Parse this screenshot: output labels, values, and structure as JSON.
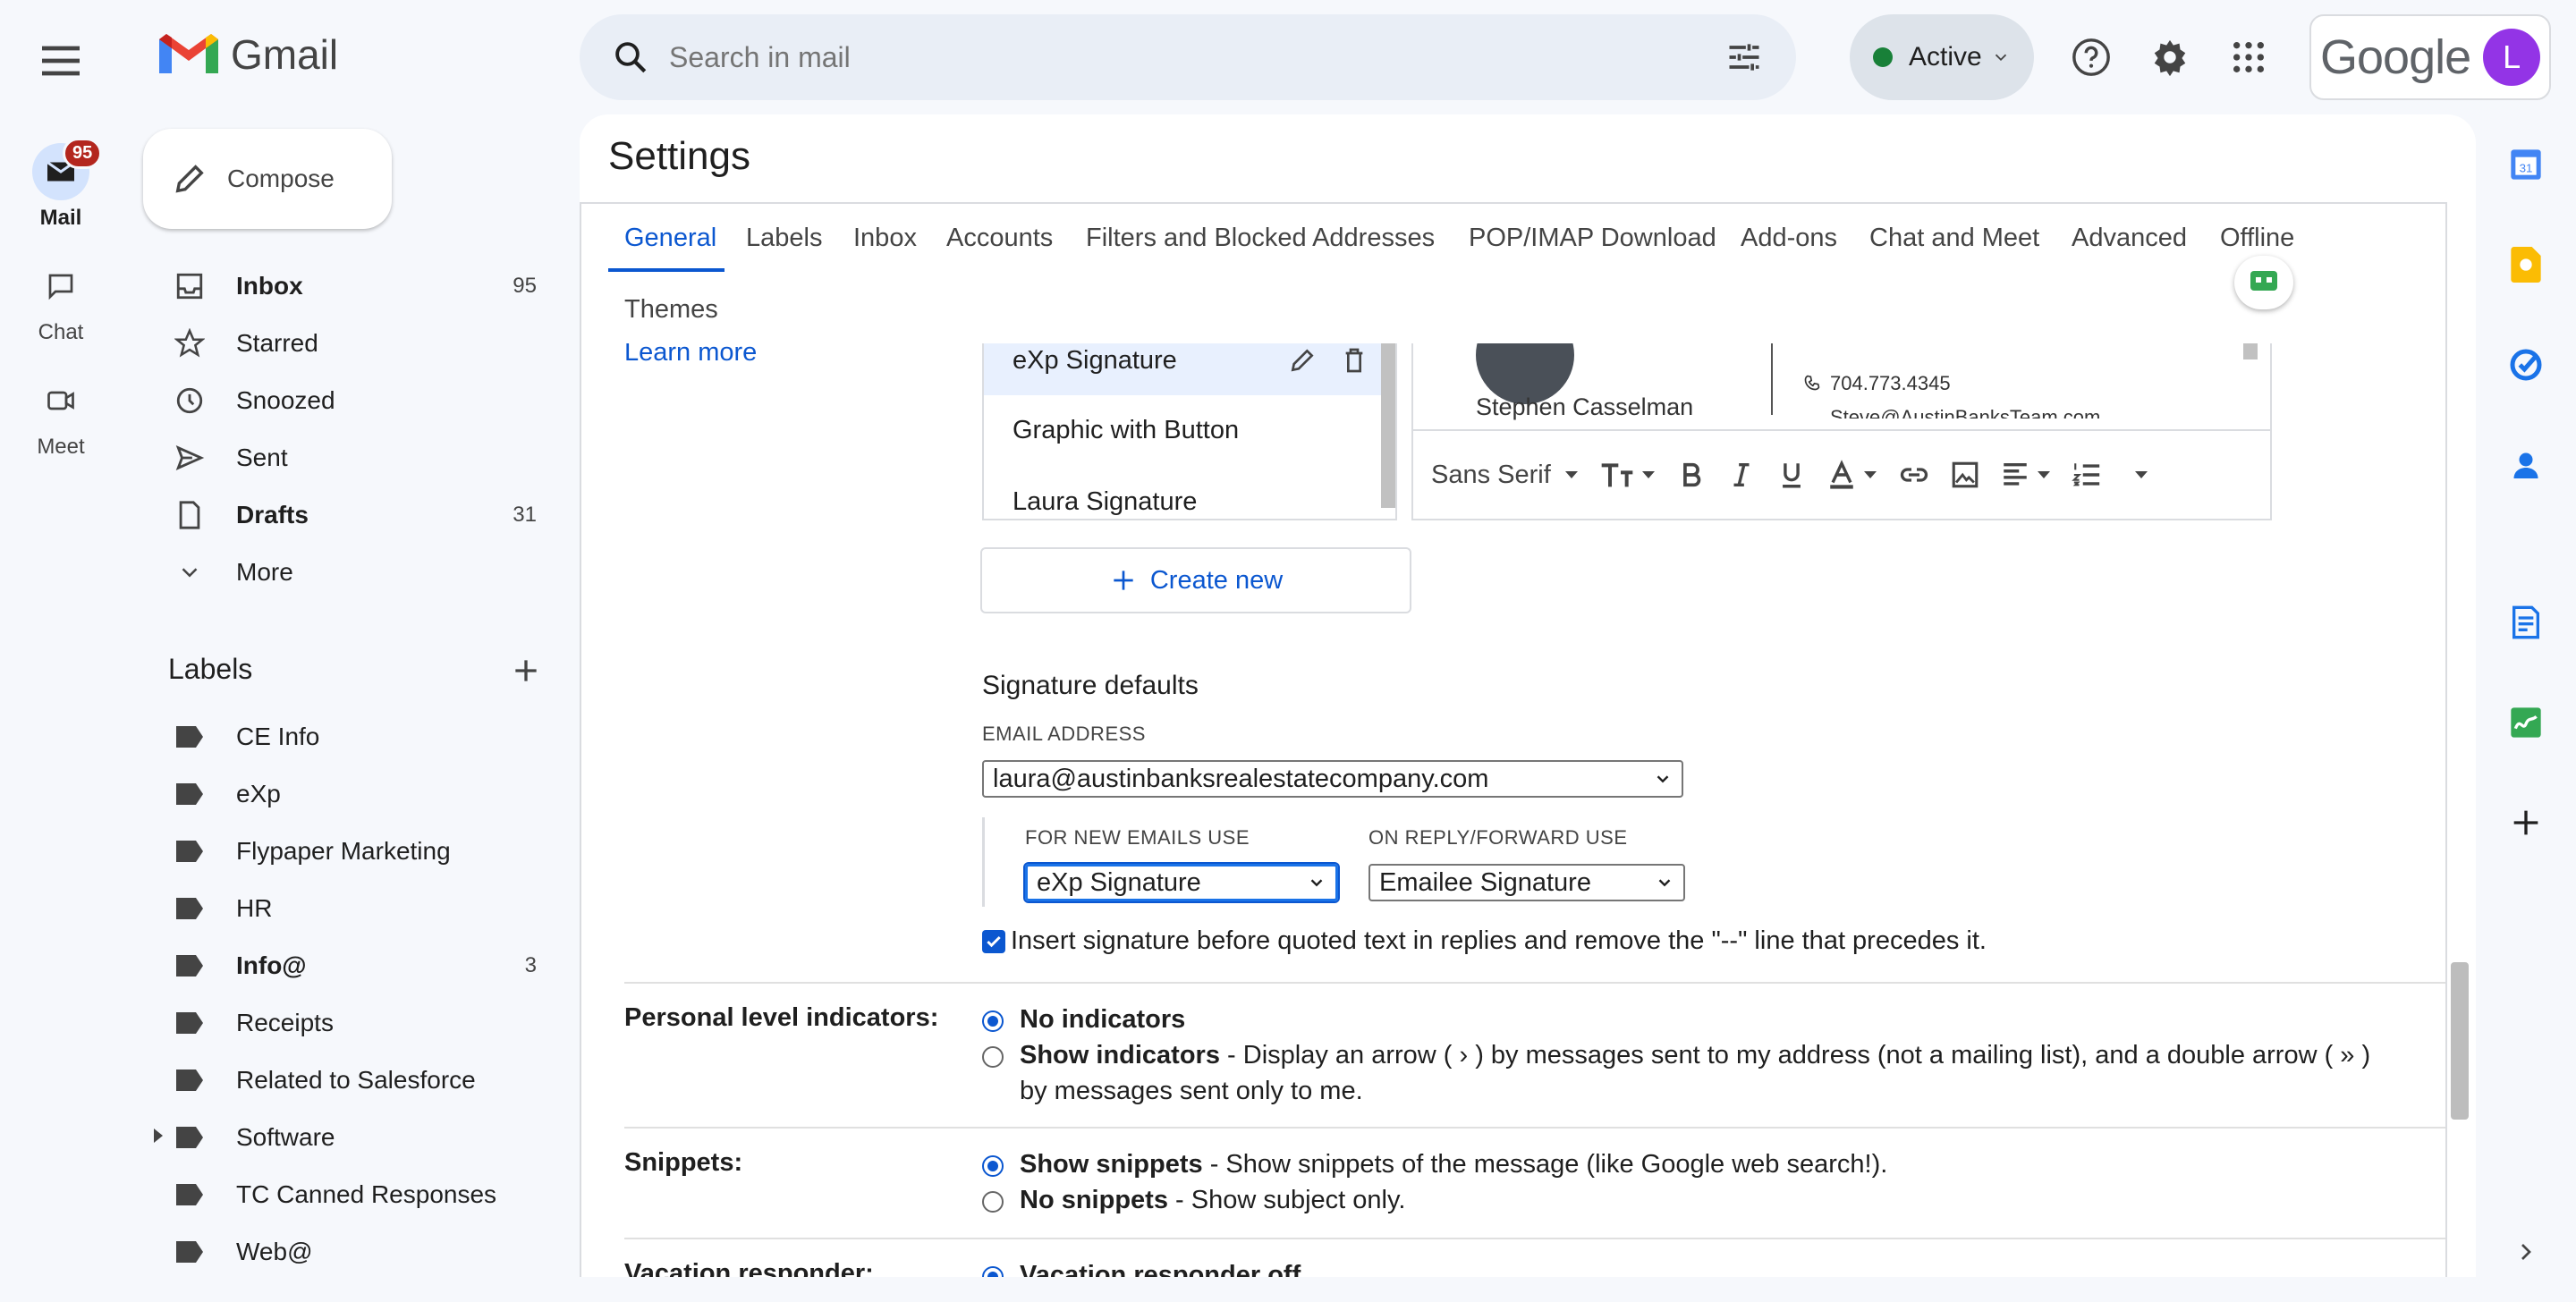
{
  "app": {
    "name": "Gmail"
  },
  "rail": {
    "mail": {
      "label": "Mail",
      "badge": "95"
    },
    "chat": {
      "label": "Chat"
    },
    "meet": {
      "label": "Meet"
    }
  },
  "compose": {
    "label": "Compose"
  },
  "nav": [
    {
      "label": "Inbox",
      "count": "95",
      "bold": true
    },
    {
      "label": "Starred",
      "count": ""
    },
    {
      "label": "Snoozed",
      "count": ""
    },
    {
      "label": "Sent",
      "count": ""
    },
    {
      "label": "Drafts",
      "count": "31",
      "bold": true
    },
    {
      "label": "More",
      "count": ""
    }
  ],
  "labels": {
    "heading": "Labels",
    "items": [
      {
        "label": "CE Info",
        "count": ""
      },
      {
        "label": "eXp",
        "count": ""
      },
      {
        "label": "Flypaper Marketing",
        "count": ""
      },
      {
        "label": "HR",
        "count": ""
      },
      {
        "label": "Info@",
        "count": "3"
      },
      {
        "label": "Receipts",
        "count": ""
      },
      {
        "label": "Related to Salesforce",
        "count": ""
      },
      {
        "label": "Software",
        "count": ""
      },
      {
        "label": "TC Canned Responses",
        "count": ""
      },
      {
        "label": "Web@",
        "count": ""
      }
    ]
  },
  "search": {
    "placeholder": "Search in mail"
  },
  "status": {
    "label": "Active"
  },
  "account": {
    "google_text": "Google",
    "avatar_letter": "L"
  },
  "settings": {
    "title": "Settings",
    "tabs": [
      "General",
      "Labels",
      "Inbox",
      "Accounts",
      "Filters and Blocked Addresses",
      "POP/IMAP Download",
      "Add-ons",
      "Chat and Meet",
      "Advanced",
      "Offline",
      "Themes"
    ],
    "active_tab": "General",
    "learn_more": "Learn more",
    "signatures": [
      "eXp Signature",
      "Graphic with Button",
      "Laura Signature"
    ],
    "create_new": "Create new",
    "preview": {
      "name": "Stephen Casselman",
      "phone": "704.773.4345",
      "email": "Steve@AustinBanksTeam.com"
    },
    "toolbar": {
      "font": "Sans Serif"
    },
    "signature_defaults": {
      "heading": "Signature defaults",
      "email_label": "EMAIL ADDRESS",
      "email_value": "laura@austinbanksrealestatecompany.com",
      "new_label": "FOR NEW EMAILS USE",
      "new_value": "eXp Signature",
      "reply_label": "ON REPLY/FORWARD USE",
      "reply_value": "Emailee Signature",
      "insert_before": "Insert signature before quoted text in replies and remove the \"--\" line that precedes it."
    },
    "personal_indicators": {
      "label": "Personal level indicators:",
      "no": "No indicators",
      "show": "Show indicators",
      "show_desc": " - Display an arrow ( › ) by messages sent to my address (not a mailing list), and a double arrow ( » ) by messages sent only to me."
    },
    "snippets": {
      "label": "Snippets:",
      "show": "Show snippets",
      "show_desc": " - Show snippets of the message (like Google web search!).",
      "no": "No snippets",
      "no_desc": " - Show subject only."
    },
    "vacation": {
      "label": "Vacation responder:",
      "off": "Vacation responder off"
    }
  },
  "colors": {
    "accent": "#0b57d0",
    "active_dot": "#188038",
    "badge": "#b3261e",
    "avatar": "#9334e6"
  }
}
